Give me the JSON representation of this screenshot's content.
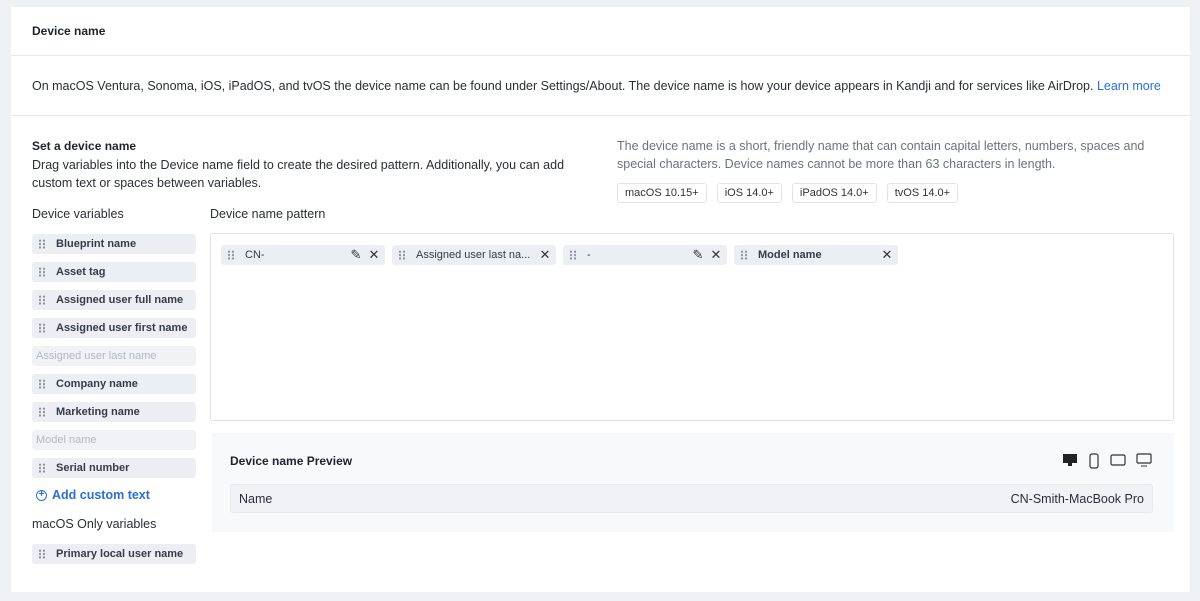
{
  "header": {
    "title": "Device name"
  },
  "description": {
    "text": "On macOS Ventura, Sonoma, iOS, iPadOS, and tvOS the device name can be found under Settings/About. The device name is how your device appears in Kandji and for services like AirDrop. ",
    "link": "Learn more"
  },
  "set": {
    "title": "Set a device name",
    "subtitle": "Drag variables into the Device name field to create the desired pattern. Additionally, you can add custom text or spaces between variables."
  },
  "note": "The device name is a short, friendly name that can contain capital letters, numbers, spaces and special characters. Device names cannot be more than 63 characters in length.",
  "badges": [
    "macOS 10.15+",
    "iOS 14.0+",
    "iPadOS 14.0+",
    "tvOS 14.0+"
  ],
  "variables_label": "Device variables",
  "variables": [
    {
      "label": "Blueprint name",
      "disabled": false
    },
    {
      "label": "Asset tag",
      "disabled": false
    },
    {
      "label": "Assigned user full name",
      "disabled": false
    },
    {
      "label": "Assigned user first name",
      "disabled": false
    },
    {
      "label": "Assigned user last name",
      "disabled": true
    },
    {
      "label": "Company name",
      "disabled": false
    },
    {
      "label": "Marketing name",
      "disabled": false
    },
    {
      "label": "Model name",
      "disabled": true
    },
    {
      "label": "Serial number",
      "disabled": false
    }
  ],
  "add_custom": "Add custom text",
  "macos_label": "macOS Only variables",
  "macos_variables": [
    {
      "label": "Primary local user name"
    }
  ],
  "pattern_label": "Device name pattern",
  "pattern": [
    {
      "label": "CN-",
      "editable": true
    },
    {
      "label": "Assigned user last na...",
      "editable": false
    },
    {
      "label": "-",
      "editable": true
    },
    {
      "label": "Model name",
      "editable": false
    }
  ],
  "preview": {
    "title": "Device name Preview",
    "name_label": "Name",
    "name_value": "CN-Smith-MacBook Pro",
    "devices": [
      "desktop-icon",
      "phone-icon",
      "tablet-icon",
      "tv-icon"
    ]
  }
}
